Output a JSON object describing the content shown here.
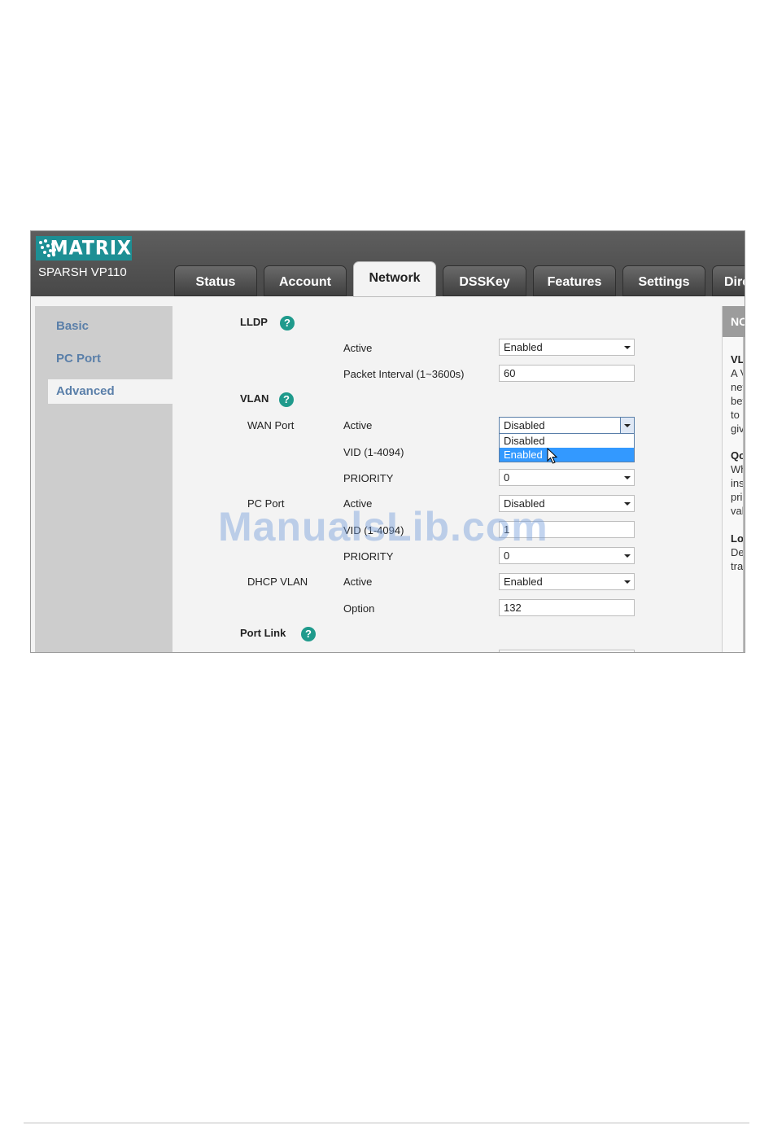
{
  "brand": {
    "logo_text": "MATRIX",
    "model": "SPARSH VP110",
    "logo_color": "#1d8f94"
  },
  "tabs": [
    {
      "label": "Status",
      "active": false
    },
    {
      "label": "Account",
      "active": false
    },
    {
      "label": "Network",
      "active": true
    },
    {
      "label": "DSSKey",
      "active": false
    },
    {
      "label": "Features",
      "active": false
    },
    {
      "label": "Settings",
      "active": false
    },
    {
      "label": "Dire",
      "active": false
    }
  ],
  "sidebar": {
    "items": [
      {
        "label": "Basic",
        "active": false
      },
      {
        "label": "PC Port",
        "active": false
      },
      {
        "label": "Advanced",
        "active": true
      }
    ]
  },
  "lldp": {
    "title": "LLDP",
    "active_label": "Active",
    "active_value": "Enabled",
    "interval_label": "Packet Interval (1~3600s)",
    "interval_value": "60"
  },
  "vlan": {
    "title": "VLAN",
    "wan": {
      "group": "WAN Port",
      "active_label": "Active",
      "active_value": "Disabled",
      "dropdown_options": [
        "Disabled",
        "Enabled"
      ],
      "highlighted_option": "Enabled",
      "vid_label": "VID (1-4094)",
      "priority_label": "PRIORITY",
      "priority_value": "0"
    },
    "pc": {
      "group": "PC Port",
      "active_label": "Active",
      "active_value": "Disabled",
      "vid_label": "VID (1-4094)",
      "vid_value": "1",
      "priority_label": "PRIORITY",
      "priority_value": "0"
    },
    "dhcp": {
      "group": "DHCP VLAN",
      "active_label": "Active",
      "active_value": "Enabled",
      "option_label": "Option",
      "option_value": "132"
    }
  },
  "port_link": {
    "title": "Port Link"
  },
  "notes": {
    "header": "NO",
    "sections": [
      {
        "title": "VL",
        "lines": [
          "A V",
          "net",
          "bet",
          "to",
          "giv"
        ]
      },
      {
        "title": "Qo",
        "lines": [
          "Wh",
          "ins",
          "pri",
          "val"
        ]
      },
      {
        "title": "Lo",
        "lines": [
          "De",
          "tra"
        ]
      }
    ]
  },
  "watermark": "ManualsLib.com",
  "colors": {
    "accent_text": "#5a7fa9",
    "help_icon": "#1f9a8c",
    "highlight": "#3399ff"
  }
}
